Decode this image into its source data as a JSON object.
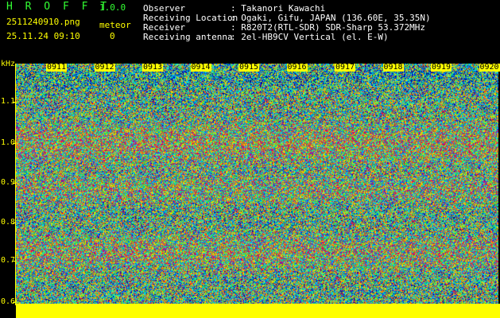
{
  "app": {
    "title_letters": "H R O F F T",
    "version": "1.0.0",
    "filename": "2511240910.png",
    "datetime": "25.11.24 09:10",
    "meteor_label": "meteor",
    "meteor_count": "0"
  },
  "info": {
    "observer_label": "Observer",
    "observer_value": ": Takanori Kawachi",
    "location_label": "Receiving Location",
    "location_value": ": Ogaki, Gifu, JAPAN (136.60E, 35.35N)",
    "receiver_label": "Receiver",
    "receiver_value": ": R820T2(RTL-SDR) SDR-Sharp 53.372MHz",
    "antenna_label": "Receiving antenna",
    "antenna_value": ": 2el-HB9CV Vertical (el. E-W)"
  },
  "axis": {
    "unit": "kHz",
    "y_ticks": [
      "1.1",
      "1.0",
      "0.9",
      "0.8",
      "0.7",
      "0.6"
    ],
    "x_ticks": [
      "0911",
      "0912",
      "0913",
      "0914",
      "0915",
      "0916",
      "0917",
      "0918",
      "0919",
      "0920"
    ]
  },
  "colors": {
    "background": "#000000",
    "axis": "#ffff00",
    "header_text": "#ffffff",
    "app_text": "#33ff33"
  }
}
